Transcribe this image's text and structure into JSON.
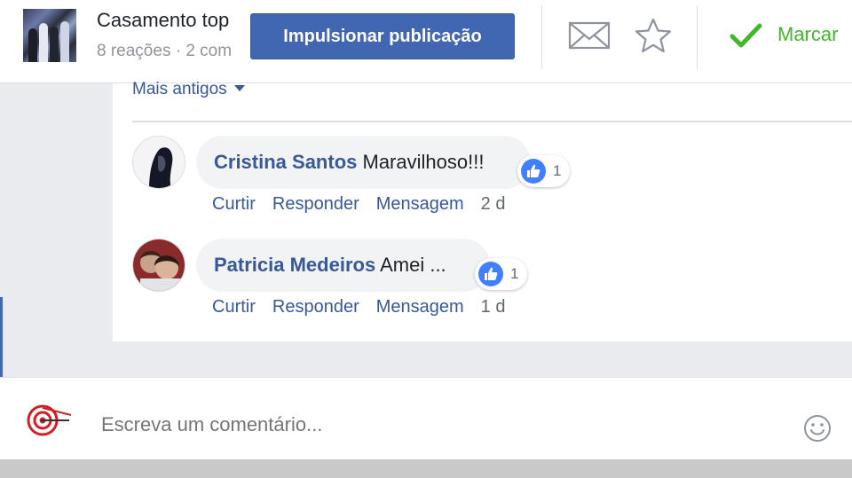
{
  "header": {
    "post_title": "Casamento top",
    "post_meta": "8 reações · 2 com",
    "boost_label": "Impulsionar publicação",
    "mark_label": "Marcar"
  },
  "comments": {
    "older_label": "Mais antigos",
    "items": [
      {
        "author": "Cristina Santos",
        "text": "Maravilhoso!!!",
        "reaction_count": "1",
        "like_label": "Curtir",
        "reply_label": "Responder",
        "message_label": "Mensagem",
        "time": "2 d"
      },
      {
        "author": "Patricia Medeiros",
        "text": "Amei ...",
        "reaction_count": "1",
        "like_label": "Curtir",
        "reply_label": "Responder",
        "message_label": "Mensagem",
        "time": "1 d"
      }
    ]
  },
  "compose": {
    "placeholder": "Escreva um comentário..."
  },
  "colors": {
    "brand": "#4267b2",
    "link": "#385898",
    "mark_green": "#42b72a",
    "like_blue": "#4080ff"
  },
  "icons": [
    "envelope-icon",
    "star-icon",
    "checkmark-icon",
    "like-icon",
    "caret-down-icon",
    "smiley-icon"
  ]
}
